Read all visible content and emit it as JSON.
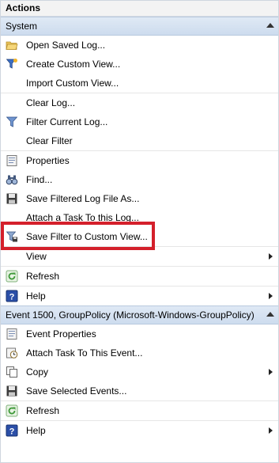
{
  "panel": {
    "title": "Actions"
  },
  "system_section": {
    "title": "System",
    "items": [
      {
        "label": "Open Saved Log...",
        "icon": "folder-open-icon"
      },
      {
        "label": "Create Custom View...",
        "icon": "funnel-star-icon"
      },
      {
        "label": "Import Custom View...",
        "icon": ""
      },
      {
        "label": "Clear Log...",
        "icon": ""
      },
      {
        "label": "Filter Current Log...",
        "icon": "funnel-icon"
      },
      {
        "label": "Clear Filter",
        "icon": ""
      },
      {
        "label": "Properties",
        "icon": "properties-icon"
      },
      {
        "label": "Find...",
        "icon": "binoculars-icon"
      },
      {
        "label": "Save Filtered Log File As...",
        "icon": "floppy-disk-icon"
      },
      {
        "label": "Attach a Task To this Log...",
        "icon": ""
      },
      {
        "label": "Save Filter to Custom View...",
        "icon": "funnel-save-icon"
      },
      {
        "label": "View",
        "icon": ""
      },
      {
        "label": "Refresh",
        "icon": "refresh-icon"
      },
      {
        "label": "Help",
        "icon": "help-icon"
      }
    ]
  },
  "event_section": {
    "title": "Event 1500, GroupPolicy (Microsoft-Windows-GroupPolicy)",
    "items": [
      {
        "label": "Event Properties",
        "icon": "properties-icon"
      },
      {
        "label": "Attach Task To This Event...",
        "icon": "task-clock-icon"
      },
      {
        "label": "Copy",
        "icon": "copy-icon"
      },
      {
        "label": "Save Selected Events...",
        "icon": "floppy-disk-icon"
      },
      {
        "label": "Refresh",
        "icon": "refresh-icon"
      },
      {
        "label": "Help",
        "icon": "help-icon"
      }
    ]
  },
  "colors": {
    "highlight": "#d4202b",
    "section_bg": "#d6e3f2",
    "help_icon": "#2b4fa8",
    "refresh_icon": "#3f9a3a"
  }
}
